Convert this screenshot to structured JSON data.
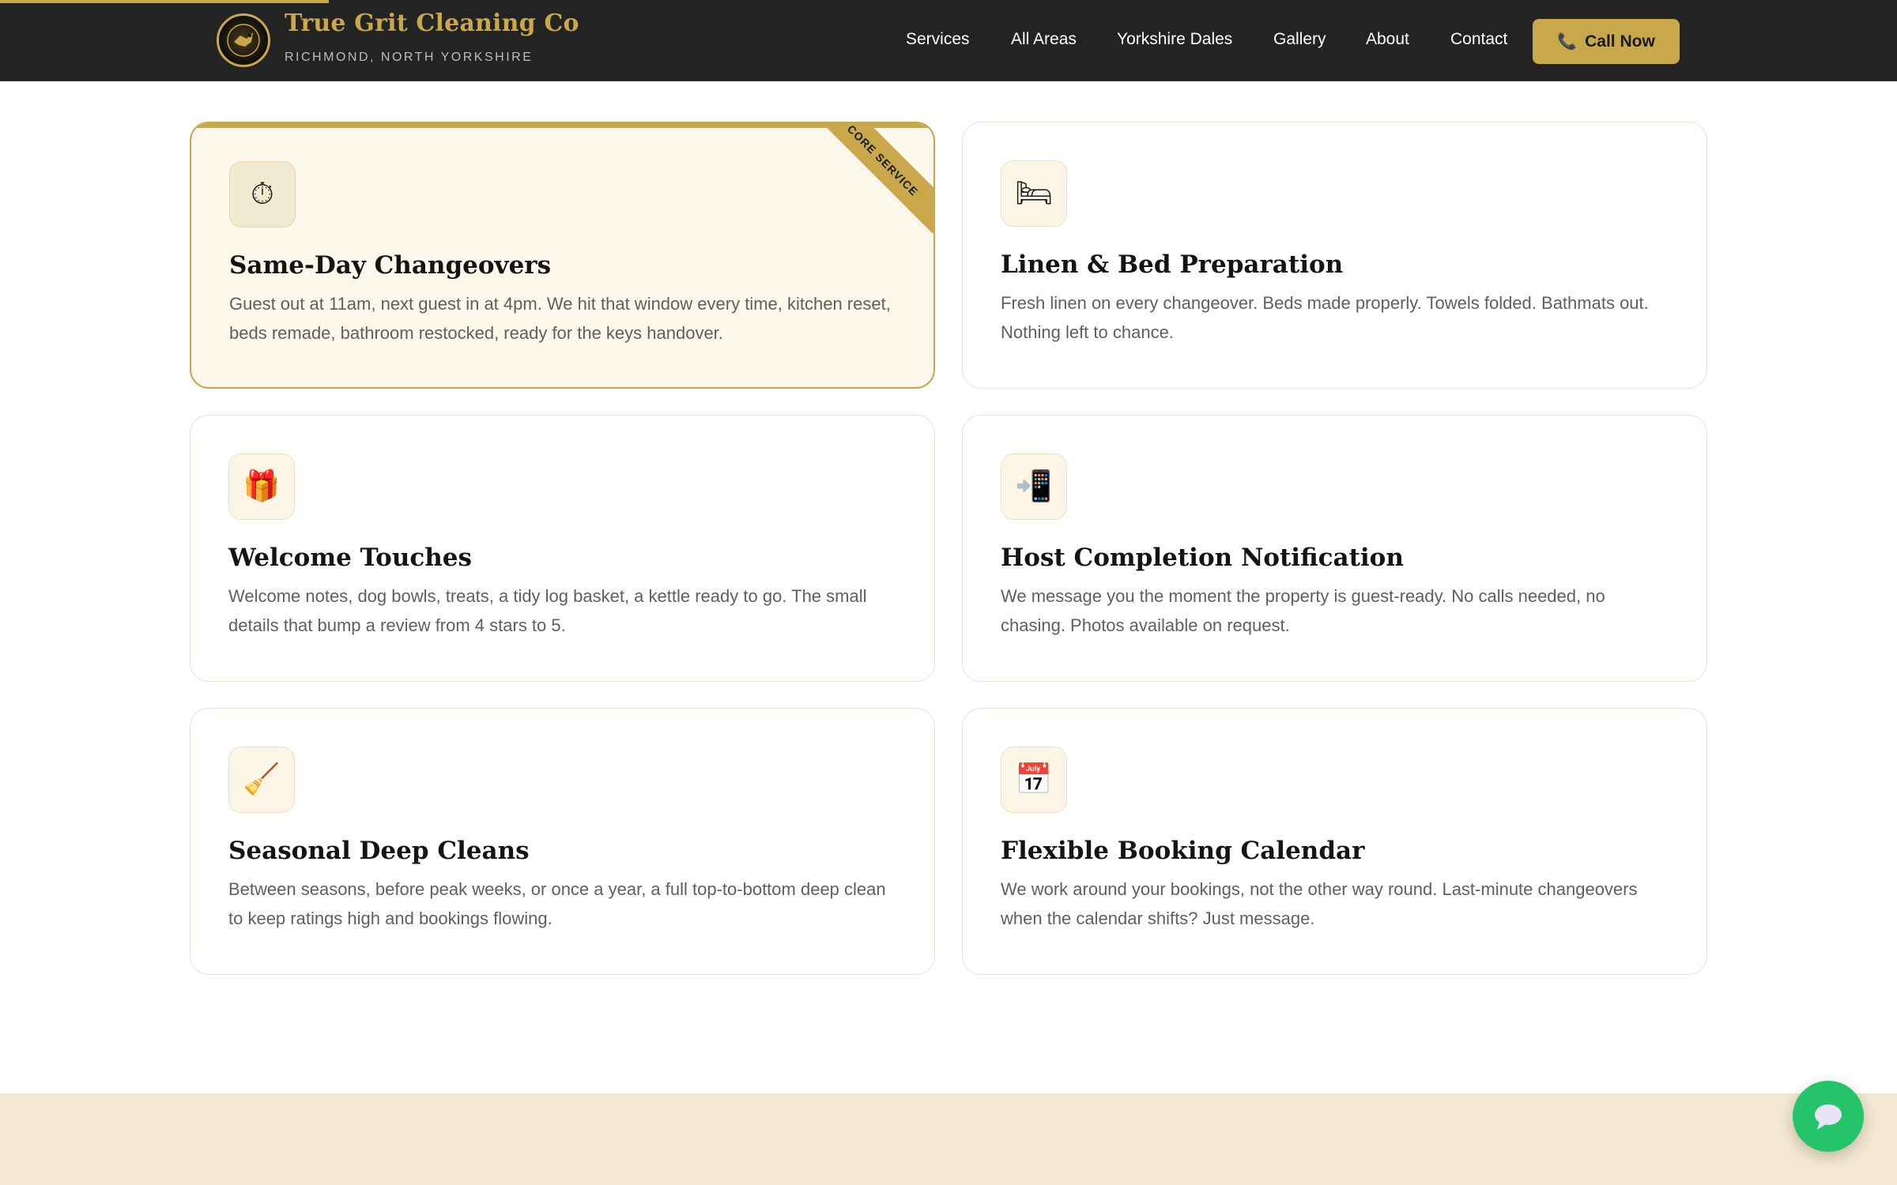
{
  "header": {
    "brand_name": "True Grit Cleaning Co",
    "brand_sub": "RICHMOND, NORTH YORKSHIRE",
    "nav": [
      "Services",
      "All Areas",
      "Yorkshire Dales",
      "Gallery",
      "About",
      "Contact"
    ],
    "call_label": "Call Now"
  },
  "services": [
    {
      "icon": "stopwatch-icon",
      "glyph": "⏱",
      "title": "Same-Day Changeovers",
      "desc": "Guest out at 11am, next guest in at 4pm. We hit that window every time, kitchen reset, beds remade, bathroom restocked, ready for the keys handover.",
      "badge": "CORE SERVICE"
    },
    {
      "icon": "bed-icon",
      "glyph": "🛏",
      "title": "Linen & Bed Preparation",
      "desc": "Fresh linen on every changeover. Beds made properly. Towels folded. Bathmats out. Nothing left to chance."
    },
    {
      "icon": "gift-icon",
      "glyph": "🎁",
      "title": "Welcome Touches",
      "desc": "Welcome notes, dog bowls, treats, a tidy log basket, a kettle ready to go. The small details that bump a review from 4 stars to 5."
    },
    {
      "icon": "phone-message-icon",
      "glyph": "📲",
      "title": "Host Completion Notification",
      "desc": "We message you the moment the property is guest-ready. No calls needed, no chasing. Photos available on request."
    },
    {
      "icon": "broom-icon",
      "glyph": "🧹",
      "title": "Seasonal Deep Cleans",
      "desc": "Between seasons, before peak weeks, or once a year, a full top-to-bottom deep clean to keep ratings high and bookings flowing."
    },
    {
      "icon": "calendar-icon",
      "glyph": "📅",
      "title": "Flexible Booking Calendar",
      "desc": "We work around your bookings, not the other way round. Last-minute changeovers when the calendar shifts? Just message."
    }
  ],
  "colors": {
    "gold": "#c9a84c",
    "header_bg": "#232323",
    "featured_bg": "#fbf7ea",
    "band_bg": "#f3e9d2",
    "chat_green": "#25c36a"
  }
}
